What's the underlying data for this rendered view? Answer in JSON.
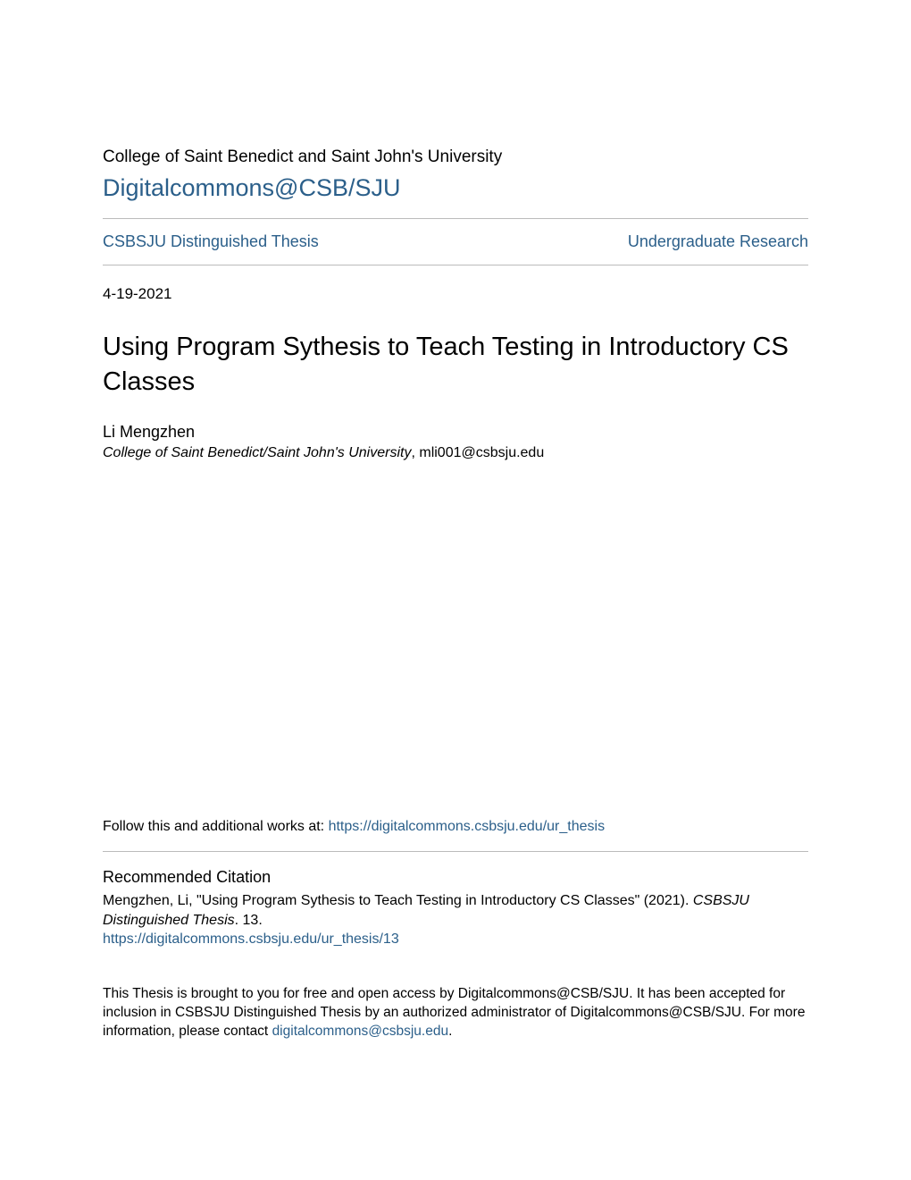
{
  "header": {
    "institution": "College of Saint Benedict and Saint John's University",
    "repository": "Digitalcommons@CSB/SJU"
  },
  "nav": {
    "left": "CSBSJU Distinguished Thesis",
    "right": "Undergraduate Research"
  },
  "date": "4-19-2021",
  "title": "Using Program Sythesis to Teach Testing in Introductory CS Classes",
  "author": {
    "name": "Li Mengzhen",
    "affiliation": "College of Saint Benedict/Saint John's University",
    "email": ", mli001@csbsju.edu"
  },
  "follow": {
    "prefix": "Follow this and additional works at: ",
    "url": "https://digitalcommons.csbsju.edu/ur_thesis"
  },
  "citation": {
    "heading": "Recommended Citation",
    "text_before_italic": "Mengzhen, Li, \"Using Program Sythesis to Teach Testing in Introductory CS Classes\" (2021). ",
    "italic_part": "CSBSJU Distinguished Thesis",
    "text_after_italic": ". 13.",
    "url": "https://digitalcommons.csbsju.edu/ur_thesis/13"
  },
  "footer": {
    "text_before_link": "This Thesis is brought to you for free and open access by Digitalcommons@CSB/SJU. It has been accepted for inclusion in CSBSJU Distinguished Thesis by an authorized administrator of Digitalcommons@CSB/SJU. For more information, please contact ",
    "link": "digitalcommons@csbsju.edu",
    "text_after_link": "."
  }
}
